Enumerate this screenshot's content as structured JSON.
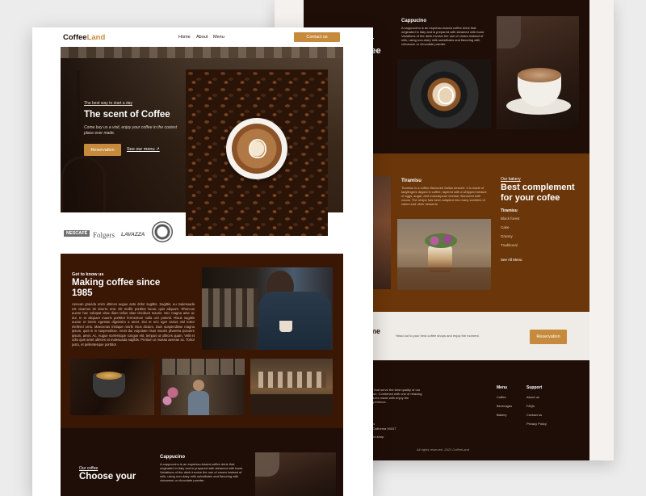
{
  "brand": {
    "part1": "Coffee",
    "part2": "Land",
    "accent": "#c58a3c"
  },
  "nav": {
    "home": "Home",
    "about": "About",
    "menu": "Menu",
    "contact": "Contact us"
  },
  "hero": {
    "eyebrow": "The best way to start a day",
    "title": "The scent of Coffee",
    "subtitle": "Come buy us a visit, enjoy your coffee in the coziest place ever made.",
    "reservation": "Reservation",
    "see_menu": "See our menu ↗"
  },
  "brands": [
    "NESCAFÉ",
    "Folgers",
    "LAVAZZA"
  ],
  "about": {
    "kicker": "Get to know us",
    "title": "Making coffee since 1985",
    "body": "Aenean gravida enim ultrices augue ante dolor sagittis. Sagittis, eu malesuada est vivamus sit viverra erat. Dit mollis porttitor lacus, quis aliquam. Rhoncus auctor hac volutpat vitae diam tellus vitae tincidunt mauris. Nec magna ante ac dui. In et aliquam mauris porttitor fermentum nulla orci potenti. Risus sagittis auctor et lorem egestas dignissim a amet. Dui et orci eget varius nisl tortor eleifend urna. Maecenas tristique morbi risus dictum. Duis suspendisse magna ipsum, quis in in suspendisse. Amet dui vulputate risus mauris pharetra posuere ipsum, amet. Ac. Augue scelerisque congue elit, tempus ut ultrices quam. Velit et odio quis amet ultrices at malesuada sagittis. Pretium ut massa aenean ac. Tortor justo, et pellentesque porttitor."
  },
  "favorites": {
    "kicker": "Our coffee",
    "title": "Choose your",
    "title_back_1": "ur",
    "title_back_2": "ffee"
  },
  "cappucino": {
    "title": "Cappucino",
    "body": "A cappuccino is an espresso-based coffee drink that originated in Italy and is prepared with steamed milk foam. Variations of the drink involve the use of cream instead of milk, using non-dairy milk substitutes and flavoring with cinnamon or chocolate powder."
  },
  "tiramisu": {
    "title": "Tiramisu",
    "body": "Tiramisu is a coffee-flavoured Italian dessert. It is made of ladyfingers dipped in coffee, layered with a whipped mixture of eggs, sugar, and mascarpone cheese, flavoured with cocoa. The recipe has been adapted into many varieties of cakes and other desserts."
  },
  "bakery": {
    "kicker": "Our bakery",
    "title": "Best complement for your cofee",
    "items": [
      "Tiramisu",
      "Black forest",
      "Cake",
      "Granny",
      "Traditional"
    ],
    "see_all": "See All Menu"
  },
  "cta": {
    "title_partial": "me",
    "text": "Head out to your best coffee shops and enjoy the moment.",
    "button": "Reservation"
  },
  "footer": {
    "about_text": "lfe that serve the best quality of our town. Combined with one of relaxing places made with enjoy the experience.",
    "address_label": "ess",
    "address": "t, California 94107",
    "email": "land.shop",
    "menu_title": "Menu",
    "menu_items": [
      "Coffee",
      "Beverages",
      "Bakery"
    ],
    "support_title": "Support",
    "support_items": [
      "About us",
      "FAQs",
      "Contact us",
      "Privacy Policy"
    ],
    "copyright": "All rights reserved. 2022 CoffeeLand"
  },
  "colors": {
    "dark": "#1f0e07",
    "brown": "#6b3609",
    "gold": "#c58a3c",
    "background": "#ececec"
  }
}
